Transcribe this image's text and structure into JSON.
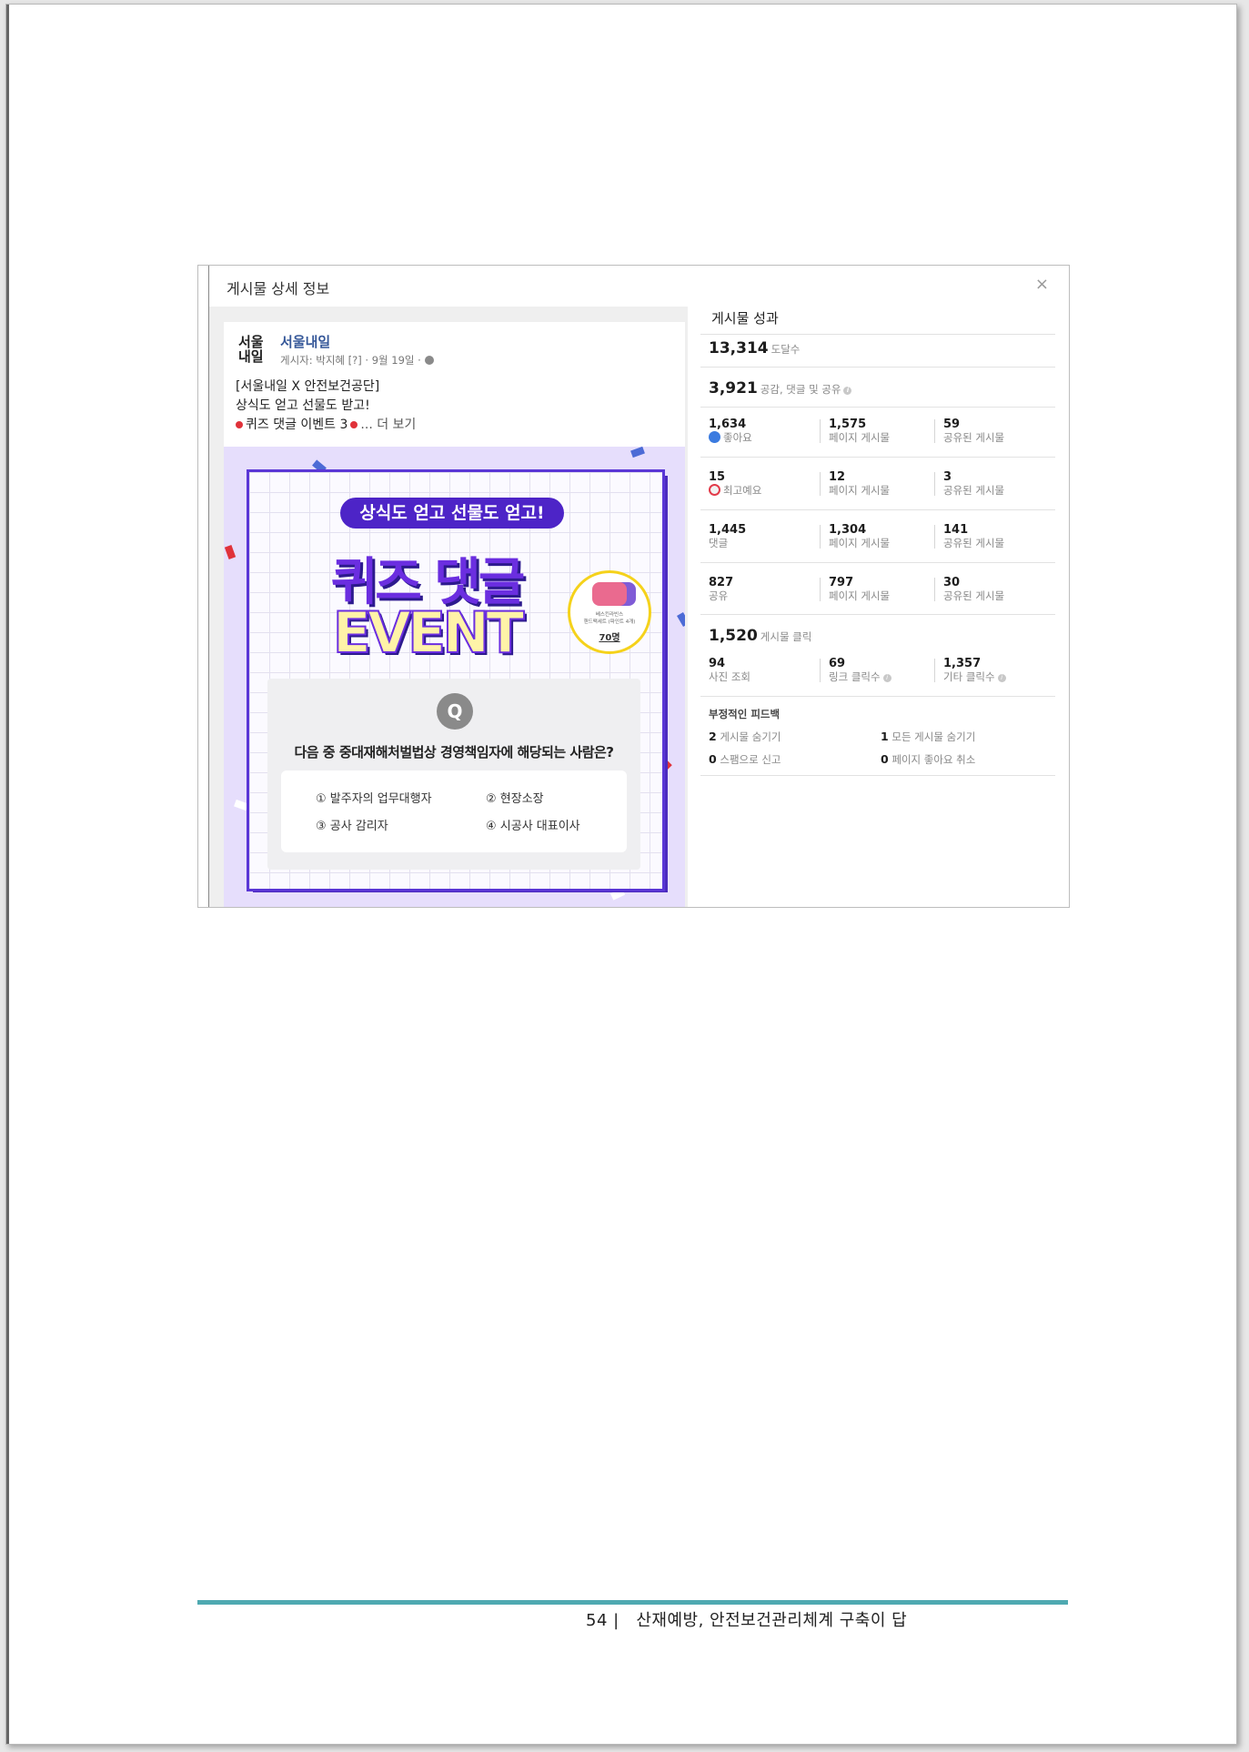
{
  "dialog": {
    "title": "게시물 상세 정보",
    "close": "×"
  },
  "post": {
    "logo": "서울\n내일",
    "page_name": "서울내일",
    "meta": "게시자: 박지혜 [?] · 9월 19일 ·",
    "text_line1": "[서울내일 X 안전보건공단]",
    "text_line2": "상식도 얻고 선물도 받고!",
    "text_line3": "퀴즈 댓글 이벤트 3",
    "see_more": "... 더 보기",
    "image": {
      "pill": "상식도 얻고 선물도 얻고!",
      "headline1": "퀴즈 댓글",
      "headline2": "EVENT",
      "prize_caption": "베스킨라빈스\n핸드팩세트 (파인트 4개)",
      "prize_count": "70명",
      "q_mark": "Q",
      "question": "다음 중 중대재해처벌법상 경영책임자에 해당되는 사람은?",
      "answers": [
        "① 발주자의 업무대행자",
        "② 현장소장",
        "③ 공사 감리자",
        "④ 시공사 대표이사"
      ]
    }
  },
  "stats": {
    "title": "게시물 성과",
    "reach": {
      "value": "13,314",
      "label": "도달수"
    },
    "engagement": {
      "value": "3,921",
      "label": "공감, 댓글 및 공유"
    },
    "rows": [
      {
        "total": "1,634",
        "label": "좋아요",
        "icon": "like-icon",
        "page": "1,575",
        "page_label": "페이지 게시물",
        "shared": "59",
        "shared_label": "공유된 게시물"
      },
      {
        "total": "15",
        "label": "최고예요",
        "icon": "love-icon",
        "page": "12",
        "page_label": "페이지 게시물",
        "shared": "3",
        "shared_label": "공유된 게시물"
      },
      {
        "total": "1,445",
        "label": "댓글",
        "icon": "",
        "page": "1,304",
        "page_label": "페이지 게시물",
        "shared": "141",
        "shared_label": "공유된 게시물"
      },
      {
        "total": "827",
        "label": "공유",
        "icon": "",
        "page": "797",
        "page_label": "페이지 게시물",
        "shared": "30",
        "shared_label": "공유된 게시물"
      }
    ],
    "clicks": {
      "value": "1,520",
      "label": "게시물 클릭"
    },
    "click_row": [
      {
        "value": "94",
        "label": "사진 조회"
      },
      {
        "value": "69",
        "label": "링크 클릭수"
      },
      {
        "value": "1,357",
        "label": "기타 클릭수"
      }
    ],
    "negative": {
      "title": "부정적인 피드백",
      "items": [
        {
          "value": "2",
          "label": "게시물 숨기기"
        },
        {
          "value": "1",
          "label": "모든 게시물 숨기기"
        },
        {
          "value": "0",
          "label": "스팸으로 신고"
        },
        {
          "value": "0",
          "label": "페이지 좋아요 취소"
        }
      ]
    }
  },
  "footer": {
    "text": "54 |   산재예방, 안전보건관리체계 구축이 답"
  },
  "colors": {
    "accent_purple": "#5a36d6",
    "footer_teal": "#4fa9b1",
    "link_blue": "#365899"
  }
}
